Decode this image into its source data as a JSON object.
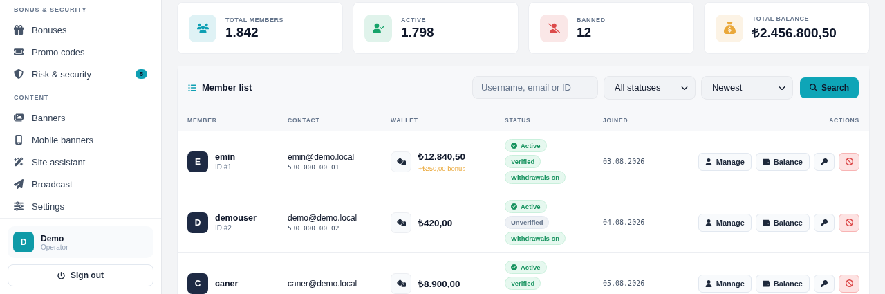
{
  "sidebar": {
    "sections": [
      {
        "title": "BONUS & SECURITY",
        "items": [
          {
            "label": "Bonuses"
          },
          {
            "label": "Promo codes"
          },
          {
            "label": "Risk & security",
            "badge": "5"
          }
        ]
      },
      {
        "title": "CONTENT",
        "items": [
          {
            "label": "Banners"
          },
          {
            "label": "Mobile banners"
          },
          {
            "label": "Site assistant"
          },
          {
            "label": "Broadcast"
          },
          {
            "label": "Settings"
          }
        ]
      }
    ],
    "user": {
      "initial": "D",
      "name": "Demo",
      "role": "Operator"
    },
    "sign_out": "Sign out"
  },
  "stats": [
    {
      "label": "TOTAL MEMBERS",
      "value": "1.842",
      "color": "#0e9fb3"
    },
    {
      "label": "ACTIVE",
      "value": "1.798",
      "color": "#16a36a"
    },
    {
      "label": "BANNED",
      "value": "12",
      "color": "#dc4a4a"
    },
    {
      "label": "TOTAL BALANCE",
      "value": "₺2.456.800,50",
      "color": "#eaa83a"
    }
  ],
  "member_list": {
    "title": "Member list",
    "search": {
      "placeholder": "Username, email or ID"
    },
    "status_filter": "All statuses",
    "sort": "Newest",
    "search_button": "Search",
    "columns": [
      "MEMBER",
      "CONTACT",
      "WALLET",
      "STATUS",
      "JOINED",
      "ACTIONS"
    ],
    "rows": [
      {
        "initial": "E",
        "username": "emin",
        "id": "ID #1",
        "email": "emin@demo.local",
        "phone": "530 000 00 01",
        "balance": "₺12.840,50",
        "bonus": "+₺250,00 bonus",
        "statuses": [
          {
            "label": "Active",
            "kind": "active"
          },
          {
            "label": "Verified",
            "kind": "positive"
          },
          {
            "label": "Withdrawals on",
            "kind": "positive"
          }
        ],
        "joined": "03.08.2026",
        "actions": [
          "Manage",
          "Balance"
        ]
      },
      {
        "initial": "D",
        "username": "demouser",
        "id": "ID #2",
        "email": "demo@demo.local",
        "phone": "530 000 00 02",
        "balance": "₺420,00",
        "statuses": [
          {
            "label": "Active",
            "kind": "active"
          },
          {
            "label": "Unverified",
            "kind": "neutral"
          },
          {
            "label": "Withdrawals on",
            "kind": "positive"
          }
        ],
        "joined": "04.08.2026",
        "actions": [
          "Manage",
          "Balance"
        ]
      },
      {
        "initial": "C",
        "username": "caner",
        "email": "caner@demo.local",
        "balance": "₺8.900,00",
        "statuses": [
          {
            "label": "Active",
            "kind": "active"
          },
          {
            "label": "Verified",
            "kind": "positive"
          }
        ],
        "joined": "05.08.2026",
        "actions": [
          "Manage",
          "Balance"
        ]
      }
    ]
  }
}
